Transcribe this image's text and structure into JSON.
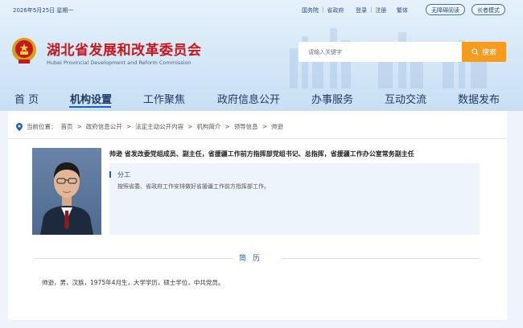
{
  "topbar": {
    "date": "2026年5月25日 星期一",
    "links": [
      "国务院",
      "省政府",
      "登录",
      "注册",
      "繁体"
    ],
    "accessible_label": "无障碍阅读",
    "elder_label": "长者模式"
  },
  "brand": {
    "title": "湖北省发展和改革委员会",
    "subtitle": "Hubei Provincial Development and Reform Commission"
  },
  "search": {
    "placeholder": "请输入关键字",
    "button_label": "搜索"
  },
  "nav": {
    "items": [
      "首 页",
      "机构设置",
      "工作聚焦",
      "政府信息公开",
      "办事服务",
      "互动交流",
      "数据发布"
    ],
    "active": "机构设置"
  },
  "breadcrumb": {
    "prefix": "当前位置：",
    "items": [
      "首页",
      "政府信息公开",
      "法定主动公开内容",
      "机构简介",
      "领导信息",
      "帅逊"
    ],
    "separator": ">"
  },
  "profile": {
    "heading": "帅逊 省发改委党组成员、副主任，省援疆工作前方指挥部党组书记、总指挥，省援疆工作办公室常务副主任",
    "duty_label": "分工",
    "duty_text": "按照省委、省政府工作安排做好省援疆工作前方指挥部工作。",
    "resume_heading": "简历",
    "resume_text": "帅逊，男，汉族，1975年4月生，大学学历，硕士学位，中共党员。"
  },
  "colors": {
    "accent": "#1f5fbf",
    "brand_red": "#c8161d",
    "search_button": "#f59b1d"
  }
}
